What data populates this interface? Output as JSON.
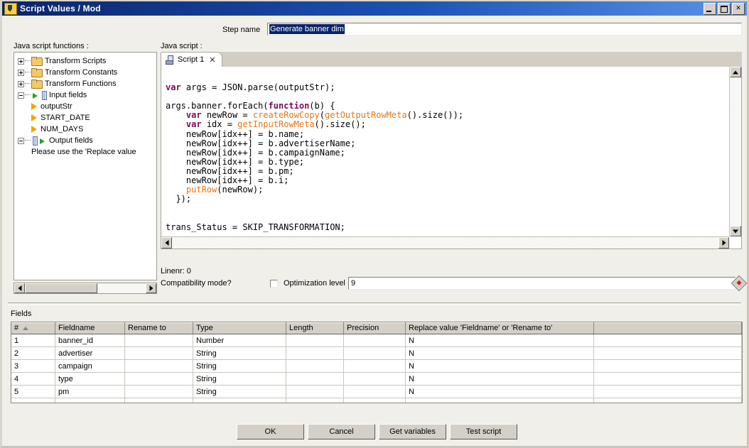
{
  "window": {
    "title": "Script Values / Mod",
    "icon": "script-icon",
    "minimize": "_",
    "maximize": "□",
    "close": "✕"
  },
  "step": {
    "label": "Step name",
    "value": "Generate banner dim"
  },
  "left_pane": {
    "label": "Java script functions :",
    "tree": [
      {
        "label": "Transform Scripts",
        "icon": "folder-icon",
        "expander": "plus",
        "level": 0
      },
      {
        "label": "Transform Constants",
        "icon": "folder-icon",
        "expander": "plus",
        "level": 0
      },
      {
        "label": "Transform Functions",
        "icon": "folder-icon",
        "expander": "plus",
        "level": 0
      },
      {
        "label": "Input fields",
        "icon": "input-fields-icon",
        "expander": "minus",
        "level": 0
      },
      {
        "label": "outputStr",
        "icon": "field-arrow-icon",
        "expander": "none",
        "level": 1
      },
      {
        "label": "START_DATE",
        "icon": "field-arrow-icon",
        "expander": "none",
        "level": 1
      },
      {
        "label": "NUM_DAYS",
        "icon": "field-arrow-icon",
        "expander": "none",
        "level": 1
      },
      {
        "label": "Output fields",
        "icon": "output-fields-icon",
        "expander": "minus",
        "level": 0
      },
      {
        "label": "Please use the 'Replace value",
        "icon": "none",
        "expander": "none",
        "level": 2
      }
    ]
  },
  "editor": {
    "label": "Java script :",
    "tab": {
      "label": "Script 1",
      "close": "✕",
      "icon": "script-tab-icon"
    },
    "code_lines": [
      [
        {
          "t": "",
          "c": "plain"
        }
      ],
      [
        {
          "t": "var",
          "c": "kw"
        },
        {
          "t": " args = JSON.parse(outputStr);",
          "c": "plain"
        }
      ],
      [
        {
          "t": "",
          "c": "plain"
        }
      ],
      [
        {
          "t": "args.banner.forEach(",
          "c": "plain"
        },
        {
          "t": "function",
          "c": "kw"
        },
        {
          "t": "(b) {",
          "c": "plain"
        }
      ],
      [
        {
          "t": "    ",
          "c": "plain"
        },
        {
          "t": "var",
          "c": "kw"
        },
        {
          "t": " newRow = ",
          "c": "plain"
        },
        {
          "t": "createRowCopy",
          "c": "fn"
        },
        {
          "t": "(",
          "c": "plain"
        },
        {
          "t": "getOutputRowMeta",
          "c": "fn"
        },
        {
          "t": "().size());",
          "c": "plain"
        }
      ],
      [
        {
          "t": "    ",
          "c": "plain"
        },
        {
          "t": "var",
          "c": "kw"
        },
        {
          "t": " idx = ",
          "c": "plain"
        },
        {
          "t": "getInputRowMeta",
          "c": "fn"
        },
        {
          "t": "().size();",
          "c": "plain"
        }
      ],
      [
        {
          "t": "    newRow[idx++] = b.name;",
          "c": "plain"
        }
      ],
      [
        {
          "t": "    newRow[idx++] = b.advertiserName;",
          "c": "plain"
        }
      ],
      [
        {
          "t": "    newRow[idx++] = b.campaignName;",
          "c": "plain"
        }
      ],
      [
        {
          "t": "    newRow[idx++] = b.type;",
          "c": "plain"
        }
      ],
      [
        {
          "t": "    newRow[idx++] = b.pm;",
          "c": "plain"
        }
      ],
      [
        {
          "t": "    newRow[idx++] = b.i;",
          "c": "plain"
        }
      ],
      [
        {
          "t": "    ",
          "c": "plain"
        },
        {
          "t": "putRow",
          "c": "fn"
        },
        {
          "t": "(newRow);",
          "c": "plain"
        }
      ],
      [
        {
          "t": "  });",
          "c": "plain"
        }
      ],
      [
        {
          "t": "",
          "c": "plain"
        }
      ],
      [
        {
          "t": "",
          "c": "plain"
        }
      ],
      [
        {
          "t": "trans_Status = SKIP_TRANSFORMATION;",
          "c": "plain"
        }
      ]
    ],
    "colors": {
      "keyword": "#7b0a52",
      "function": "#e8771a",
      "text": "#000000"
    }
  },
  "status": {
    "linenr": "Linenr: 0",
    "compatibility_label": "Compatibility mode?",
    "compatibility_checked": false,
    "optimization_label": "Optimization level",
    "optimization_value": "9"
  },
  "fields": {
    "label": "Fields",
    "columns": [
      "#",
      "Fieldname",
      "Rename to",
      "Type",
      "Length",
      "Precision",
      "Replace value 'Fieldname' or 'Rename to'",
      ""
    ],
    "sorted_column": "#",
    "sort_direction": "asc",
    "rows": [
      {
        "num": "1",
        "fieldname": "banner_id",
        "rename": "",
        "type": "Number",
        "length": "",
        "precision": "",
        "replace": "N",
        "extra": ""
      },
      {
        "num": "2",
        "fieldname": "advertiser",
        "rename": "",
        "type": "String",
        "length": "",
        "precision": "",
        "replace": "N",
        "extra": ""
      },
      {
        "num": "3",
        "fieldname": "campaign",
        "rename": "",
        "type": "String",
        "length": "",
        "precision": "",
        "replace": "N",
        "extra": ""
      },
      {
        "num": "4",
        "fieldname": "type",
        "rename": "",
        "type": "String",
        "length": "",
        "precision": "",
        "replace": "N",
        "extra": ""
      },
      {
        "num": "5",
        "fieldname": "pm",
        "rename": "",
        "type": "String",
        "length": "",
        "precision": "",
        "replace": "N",
        "extra": ""
      },
      {
        "num": "",
        "fieldname": "",
        "rename": "",
        "type": "",
        "length": "",
        "precision": "",
        "replace": "",
        "extra": ""
      }
    ]
  },
  "buttons": {
    "ok": "OK",
    "cancel": "Cancel",
    "get_variables": "Get variables",
    "test_script": "Test script"
  }
}
